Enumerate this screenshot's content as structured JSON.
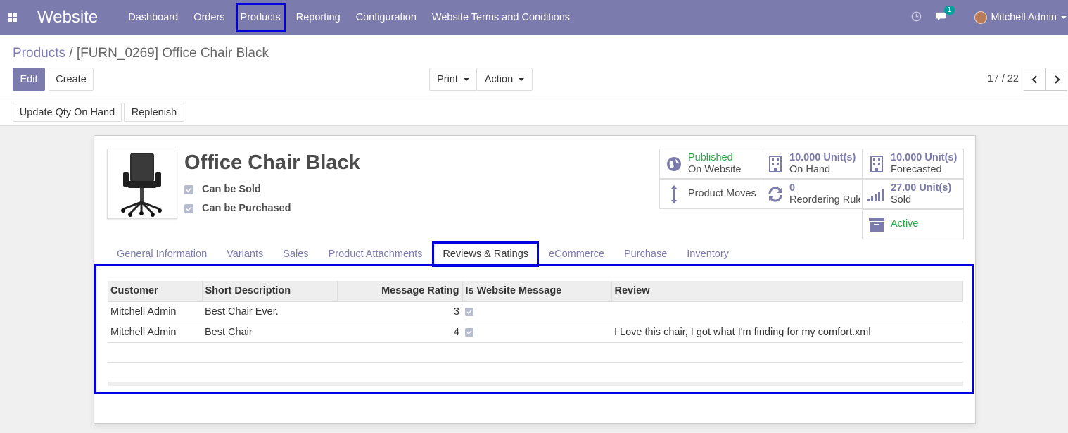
{
  "nav": {
    "brand": "Website",
    "menu": [
      "Dashboard",
      "Orders",
      "Products",
      "Reporting",
      "Configuration",
      "Website Terms and Conditions"
    ],
    "highlighted_menu": "Products",
    "chat_badge": "1",
    "user": "Mitchell Admin",
    "accent": "#7c7bad"
  },
  "breadcrumb": {
    "parent": "Products",
    "separator": "/",
    "current": "[FURN_0269] Office Chair Black"
  },
  "buttons": {
    "edit": "Edit",
    "create": "Create",
    "print": "Print",
    "action": "Action"
  },
  "pager": {
    "text": "17 / 22"
  },
  "status_buttons": {
    "update_qty": "Update Qty On Hand",
    "replenish": "Replenish"
  },
  "product": {
    "name": "Office Chair Black",
    "can_be_sold": "Can be Sold",
    "can_be_purchased": "Can be Purchased"
  },
  "stats": {
    "published": {
      "value": "Published",
      "label": "On Website",
      "icon": "globe-icon"
    },
    "on_hand": {
      "value": "10.000 Unit(s)",
      "label": "On Hand",
      "icon": "building-icon"
    },
    "forecasted": {
      "value": "10.000 Unit(s)",
      "label": "Forecasted",
      "icon": "building-icon"
    },
    "moves": {
      "label": "Product Moves",
      "icon": "arrows-vertical-icon"
    },
    "reordering": {
      "value": "0",
      "label": "Reordering Rules",
      "icon": "refresh-icon"
    },
    "sold": {
      "value": "27.00 Unit(s)",
      "label": "Sold",
      "icon": "signal-bars-icon"
    },
    "active": {
      "label": "Active",
      "icon": "archive-icon"
    }
  },
  "tabs": [
    "General Information",
    "Variants",
    "Sales",
    "Product Attachments",
    "Reviews & Ratings",
    "eCommerce",
    "Purchase",
    "Inventory"
  ],
  "active_tab": "Reviews & Ratings",
  "reviews": {
    "columns": [
      "Customer",
      "Short Description",
      "Message Rating",
      "Is Website Message",
      "Review"
    ],
    "rows": [
      {
        "customer": "Mitchell Admin",
        "short": "Best Chair Ever.",
        "rating": "3",
        "website": true,
        "review": ""
      },
      {
        "customer": "Mitchell Admin",
        "short": "Best Chair",
        "rating": "4",
        "website": true,
        "review": "I Love this chair,  I got what I'm finding for my comfort.xml"
      }
    ]
  }
}
